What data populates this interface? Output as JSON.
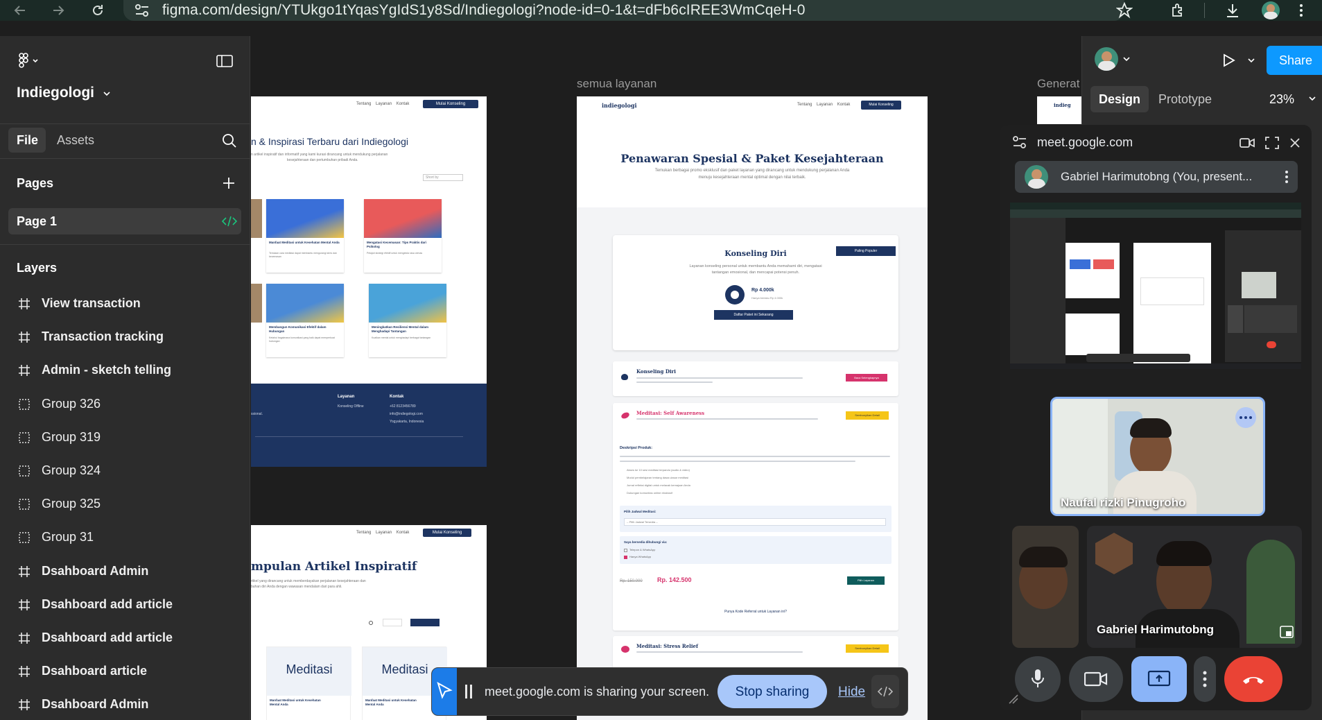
{
  "browser": {
    "url": "figma.com/design/YTUkgo1tYqasYgIdS1y8Sd/Indiegologi?node-id=0-1&t=dFb6cIREE3WmCqeH-0"
  },
  "figma": {
    "file_name": "Indiegologi",
    "tabs": [
      "File",
      "Assets"
    ],
    "pages_title": "Pages",
    "current_page": "Page 1",
    "layers_title": "Layers",
    "layers": [
      {
        "type": "frame",
        "name": "View transaction"
      },
      {
        "type": "frame",
        "name": "Transaction tracking"
      },
      {
        "type": "frame",
        "name": "Admin - sketch telling"
      },
      {
        "type": "group",
        "name": "Group 326"
      },
      {
        "type": "group",
        "name": "Group 319"
      },
      {
        "type": "group",
        "name": "Group 324"
      },
      {
        "type": "group",
        "name": "Group 325"
      },
      {
        "type": "group",
        "name": "Group 31"
      },
      {
        "type": "frame",
        "name": "Dsahboard Admin"
      },
      {
        "type": "frame",
        "name": "Dsahboard add article"
      },
      {
        "type": "frame",
        "name": "Dsahboard add article"
      },
      {
        "type": "frame",
        "name": "Dsahboard article"
      },
      {
        "type": "frame",
        "name": "Dsahboard Admin"
      }
    ],
    "right_tabs": [
      "Design",
      "Prototype"
    ],
    "zoom": "23%",
    "share_label": "Share"
  },
  "canvas": {
    "frame_labels": {
      "middle": "semua layanan",
      "right": "Generat"
    },
    "left_frame": {
      "nav": [
        "Tentang",
        "Layanan",
        "Kontak"
      ],
      "nav_button": "Mulai Konseling",
      "heading": "n & Inspirasi Terbaru dari Indiegologi",
      "sub1": "n artikel inspiratif dan informatif yang kami kurasi dirancang untuk mendukung perjalanan",
      "sub2": "kesejahteraan dan pertumbuhan pribadi Anda.",
      "sort": "Short by",
      "cards": [
        {
          "title": "Manfaat Meditasi untuk Kesehatan Mental Anda",
          "text": "Temukan cara meditasi dapat membantu mengurangi stres dan kecemasan"
        },
        {
          "title": "Mengatasi Kecemasan: Tips Praktis dari Psikolog",
          "text": "Pelajari strategi efektif untuk mengelola rasa cemas"
        },
        {
          "title": "Membangun Komunikasi Efektif dalam Hubungan",
          "text": "Ketahui bagaimana komunikasi yang baik dapat memperkuat hubungan"
        },
        {
          "title": "Meningkatkan Resiliensi Mental dalam Menghadapi Tantangan",
          "text": "Kuatkan mental untuk menghadapi berbagai tantangan"
        }
      ],
      "footer": {
        "col1_title": "Layanan",
        "col1_item": "Konseling Offline",
        "col2_title": "Kontak",
        "col2_lines": [
          "+62 8123456789",
          "info@indiegologi.com",
          "Yogyakarta, Indonesia"
        ],
        "left_line": "ssional."
      },
      "article_nav": [
        "Tentang",
        "Layanan",
        "Kontak"
      ],
      "article_nav_button": "Mulai Konseling",
      "article_heading": "mpulan Artikel Inspiratif",
      "article_sub": "rtikel yang dirancang untuk memberdayakan perjalanan kesejahteraan dan",
      "article_sub2": "buhan diri Anda dengan wawasan mendalam dari para ahli.",
      "article_cards": [
        {
          "title": "Meditasi",
          "caption": "Manfaat Meditasi untuk Kesehatan Mental Anda"
        },
        {
          "title": "Meditasi",
          "caption": "Manfaat Meditasi untuk Kesehatan Mental Anda"
        }
      ]
    },
    "middle_frame": {
      "logo": "indiegologi",
      "nav": [
        "Tentang",
        "Layanan",
        "Kontak"
      ],
      "nav_button": "Mulai Konseling",
      "hero_title": "Penawaran Spesial & Paket Kesejahteraan",
      "hero_sub1": "Temukan berbagai promo eksklusif dan paket layanan yang dirancang untuk mendukung perjalanan Anda",
      "hero_sub2": "menuju kesejahteraan mental optimal dengan nilai terbaik.",
      "featured": {
        "title": "Konseling Diri",
        "badge": "Paling Populer",
        "desc1": "Layanan konseling personal untuk membantu Anda memahami diri, mengatasi",
        "desc2": "tantangan emosional, dan mencapai potensi penuh.",
        "price": "Rp 4.000k",
        "price_note": "Hanya berlaku Rp 4.000k",
        "cta": "Daftar Paket ini Sekarang"
      },
      "items": [
        {
          "title": "Konseling Diri",
          "button": "Baca Selengkapnya"
        },
        {
          "title": "Meditasi: Self Awareness",
          "button": "Sembunyikan Detail"
        }
      ],
      "detail": {
        "section": "Deskripsi Produk:",
        "bullets": [
          "Akses ke 10 sesi meditasi terpandu (audio & video)",
          "Modul pembelajaran tentang dasar-dasar meditasi",
          "Jurnal refleksi digital untuk melacak kemajuan Anda",
          "Dukungan komunitas online eksklusif"
        ],
        "schedule_label": "Pilih Jadwal Meditasi:",
        "schedule_placeholder": "-- Pilih Jadwal Tersedia --",
        "contact_label": "Saya bersedia dihubungi via:",
        "contact_options": [
          "Telepon & WhatsApp",
          "Hanya WhatsApp"
        ],
        "old_price": "Rp. 150.000",
        "price": "Rp. 142.500",
        "choose": "Pilih Layanan",
        "referral": "Punya Kode Referral untuk Layanan ini?"
      },
      "last_item": {
        "title": "Meditasi: Stress Relief",
        "button": "Sembunyikan Detail"
      }
    }
  },
  "meet": {
    "domain": "meet.google.com",
    "presenter": "Gabriel Harimutobng (You, present...",
    "participants": [
      {
        "name": "Naufal rizki Pinugroho"
      },
      {
        "name": "Gabriel Harimutobng"
      }
    ]
  },
  "sharing": {
    "message": "meet.google.com is sharing your screen.",
    "stop": "Stop sharing",
    "hide": "Hide"
  },
  "colors": {
    "figma_bg": "#2c2c2c",
    "canvas_bg": "#1e1e1e",
    "share_blue": "#0d99ff",
    "navy": "#1d3461",
    "pink": "#d6336c",
    "yellow": "#f5c518",
    "teal": "#0f5c5c",
    "meet_red": "#ea4335",
    "meet_blue": "#8ab4f8"
  }
}
